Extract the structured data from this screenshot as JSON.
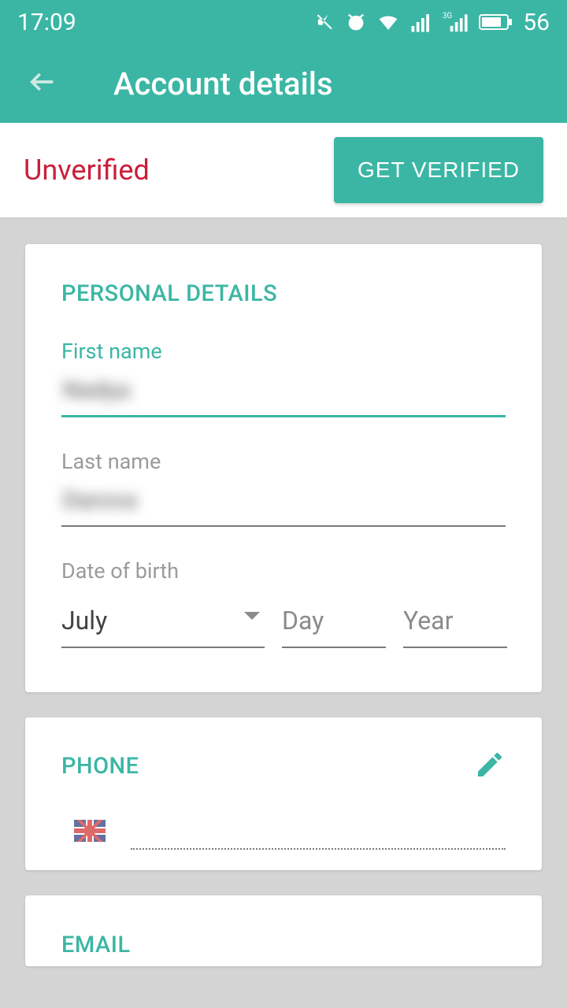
{
  "status": {
    "time": "17:09",
    "battery": "56"
  },
  "header": {
    "title": "Account details"
  },
  "verify": {
    "status": "Unverified",
    "button": "GET VERIFIED"
  },
  "personal": {
    "title": "PERSONAL DETAILS",
    "first_name_label": "First name",
    "first_name_value": "Nadya",
    "last_name_label": "Last name",
    "last_name_value": "Darova",
    "dob_label": "Date of birth",
    "dob_month": "July",
    "dob_day_placeholder": "Day",
    "dob_year_placeholder": "Year"
  },
  "phone": {
    "title": "PHONE",
    "country": "uk",
    "value": ""
  },
  "email": {
    "title": "EMAIL"
  }
}
